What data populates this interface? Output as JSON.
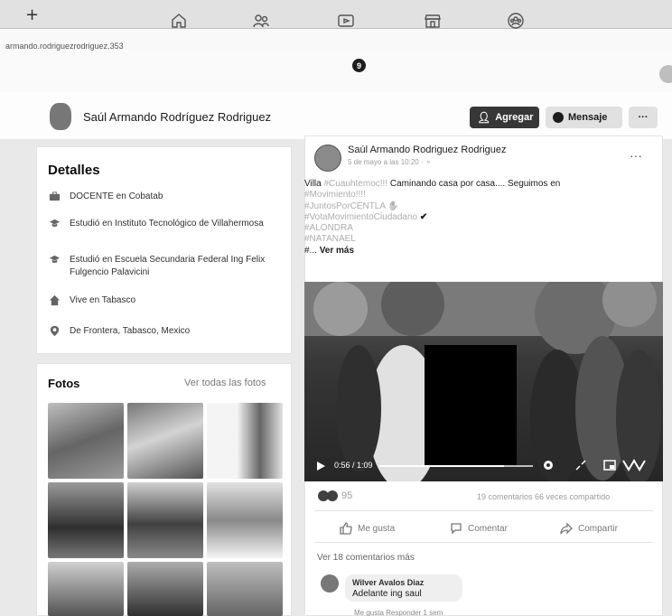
{
  "browser": {
    "new_tab": "+",
    "url": "armando.rodriguezrodriguez.353"
  },
  "nav": {
    "icons": [
      "home-icon",
      "friends-icon",
      "watch-icon",
      "marketplace-icon",
      "groups-icon"
    ],
    "watch_badge": "9"
  },
  "profile": {
    "name": "Saúl Armando Rodríguez Rodriguez",
    "add_label": "Agregar",
    "message_label": "Mensaje",
    "more_label": "···"
  },
  "details": {
    "title": "Detalles",
    "items": [
      {
        "icon": "briefcase-icon",
        "text": "DOCENTE en Cobatab"
      },
      {
        "icon": "graduation-cap-icon",
        "text": "Estudió en Instituto Tecnológico de Villahermosa"
      },
      {
        "icon": "graduation-cap-icon",
        "text": "Estudió en Escuela Secundaria Federal Ing Felix Fulgencio Palavicini"
      },
      {
        "icon": "house-icon",
        "text": "Vive en Tabasco"
      },
      {
        "icon": "location-pin-icon",
        "text": "De Frontera, Tabasco, Mexico"
      }
    ]
  },
  "photos": {
    "title": "Fotos",
    "see_all": "Ver todas las fotos"
  },
  "post": {
    "author": "Saúl Armando Rodriguez Rodriguez",
    "date": "5 de mayo a las 10:20 ·",
    "more": "···",
    "lines": [
      {
        "text": "Villa ",
        "tag": "#Cuauhtemoc!!!",
        "rest": " Caminando casa por casa.... Seguimos en"
      },
      {
        "text": "",
        "tag": "#Movimiento!!!!",
        "rest": ""
      },
      {
        "text": "",
        "tag": "#JuntosPorCENTLA",
        "rest": ""
      },
      {
        "text": "",
        "tag": "#VotaMovimientoCiudadano",
        "rest": ""
      },
      {
        "text": "",
        "tag": "#ALONDRA",
        "rest": ""
      },
      {
        "text": "",
        "tag": "#NATANAEL",
        "rest": ""
      }
    ],
    "last_line_prefix": "#...",
    "see_more": "Ver más",
    "video": {
      "time": "0:56 / 1:09",
      "progress": 0.81
    },
    "reaction_count": "95",
    "counts": "19 comentarios  66 veces compartido",
    "actions": {
      "like": "Me gusta",
      "comment": "Comentar",
      "share": "Compartir"
    },
    "view_more_comments": "Ver 18 comentarios más",
    "comment": {
      "author": "Wilver Avalos Diaz",
      "text": "Adelante ing saul",
      "actions": "Me gusta  Responder  1 sem"
    }
  }
}
